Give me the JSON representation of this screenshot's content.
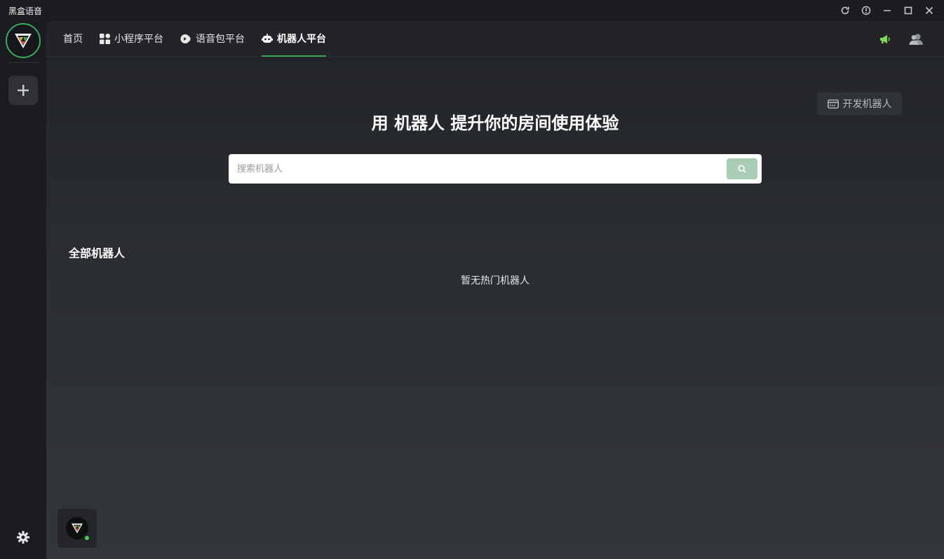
{
  "window": {
    "title": "黑盒语音",
    "controls": [
      "refresh-icon",
      "info-icon",
      "minimize-icon",
      "maximize-icon",
      "close-icon"
    ]
  },
  "sidebar": {
    "logo_icon": "brand-logo-icon",
    "add_icon": "plus-icon",
    "settings_icon": "gear-icon"
  },
  "nav": {
    "items": [
      {
        "label": "首页",
        "icon": null,
        "active": false
      },
      {
        "label": "小程序平台",
        "icon": "apps-grid-icon",
        "active": false
      },
      {
        "label": "语音包平台",
        "icon": "voice-pack-icon",
        "active": false
      },
      {
        "label": "机器人平台",
        "icon": "robot-icon",
        "active": true
      }
    ],
    "right_icons": [
      "megaphone-icon",
      "users-icon"
    ]
  },
  "main": {
    "dev_button_label": "开发机器人",
    "hero_title": "用 机器人 提升你的房间使用体验",
    "search": {
      "placeholder": "搜索机器人",
      "value": ""
    },
    "section_title": "全部机器人",
    "empty_text": "暂无热门机器人"
  },
  "colors": {
    "accent": "#3aa95c",
    "search_button": "#a8cdb4",
    "megaphone": "#7ed957"
  }
}
